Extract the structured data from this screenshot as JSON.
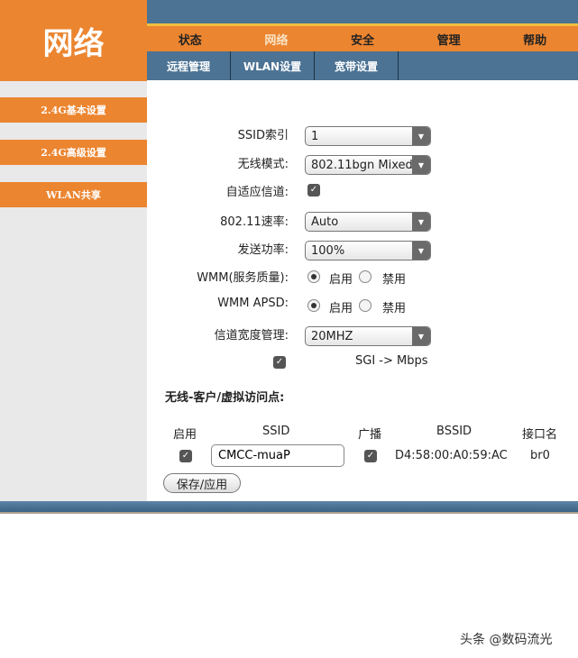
{
  "header": {
    "title": "网络"
  },
  "main_nav": [
    {
      "label": "状态"
    },
    {
      "label": "网络",
      "active": true
    },
    {
      "label": "安全"
    },
    {
      "label": "管理"
    },
    {
      "label": "帮助"
    }
  ],
  "sub_nav": [
    {
      "label": "远程管理"
    },
    {
      "label": "WLAN设置"
    },
    {
      "label": "宽带设置"
    }
  ],
  "sidebar": [
    {
      "label": "2.4G基本设置"
    },
    {
      "label": "2.4G高级设置"
    },
    {
      "label": "WLAN共享"
    }
  ],
  "form": {
    "ssid_index": {
      "label": "SSID索引",
      "value": "1"
    },
    "wireless_mode": {
      "label": "无线模式:",
      "value": "802.11bgn Mixed"
    },
    "auto_channel": {
      "label": "自适应信道:",
      "checked": true
    },
    "rate": {
      "label": "802.11速率:",
      "value": "Auto"
    },
    "tx_power": {
      "label": "发送功率:",
      "value": "100%"
    },
    "wmm": {
      "label": "WMM(服务质量):",
      "enable": "启用",
      "disable": "禁用",
      "selected": "启用"
    },
    "wmm_apsd": {
      "label": "WMM APSD:",
      "enable": "启用",
      "disable": "禁用",
      "selected": "启用"
    },
    "bandwidth": {
      "label": "信道宽度管理:",
      "value": "20MHZ"
    },
    "sgi": {
      "label": "SGI -> Mbps",
      "checked": true
    }
  },
  "vap": {
    "title": "无线-客户/虚拟访问点:",
    "columns": [
      "启用",
      "SSID",
      "广播",
      "BSSID",
      "接口名"
    ],
    "row": {
      "enabled": true,
      "ssid": "CMCC-muaP",
      "broadcast": true,
      "bssid": "D4:58:00:A0:59:AC",
      "ifname": "br0"
    }
  },
  "save_label": "保存/应用",
  "watermark": "头条 @数码流光"
}
